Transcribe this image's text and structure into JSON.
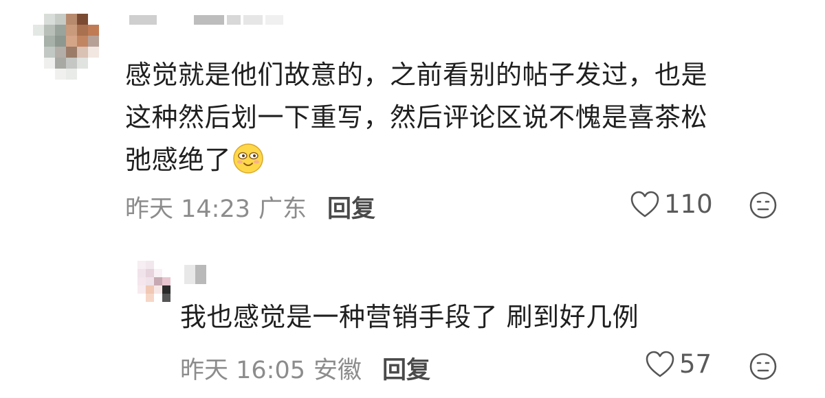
{
  "comments": [
    {
      "text_lines": [
        "感觉就是他们故意的，之前看别的帖子发过，也是",
        "这种然后划一下重写，然后评论区说不愧是喜茶松",
        "弛感绝了"
      ],
      "emoji_icon": "grinning-face-icon",
      "time": "昨天 14:23",
      "location": "广东",
      "reply_label": "回复",
      "likes": "110"
    },
    {
      "text_lines": [
        "我也感觉是一种营销手段了 刷到好几例"
      ],
      "time": "昨天 16:05",
      "location": "安徽",
      "reply_label": "回复",
      "likes": "57"
    }
  ],
  "colors": {
    "meta_text": "#8c8c8c",
    "body_text": "#1f1f1f",
    "icon_stroke": "#555555"
  }
}
